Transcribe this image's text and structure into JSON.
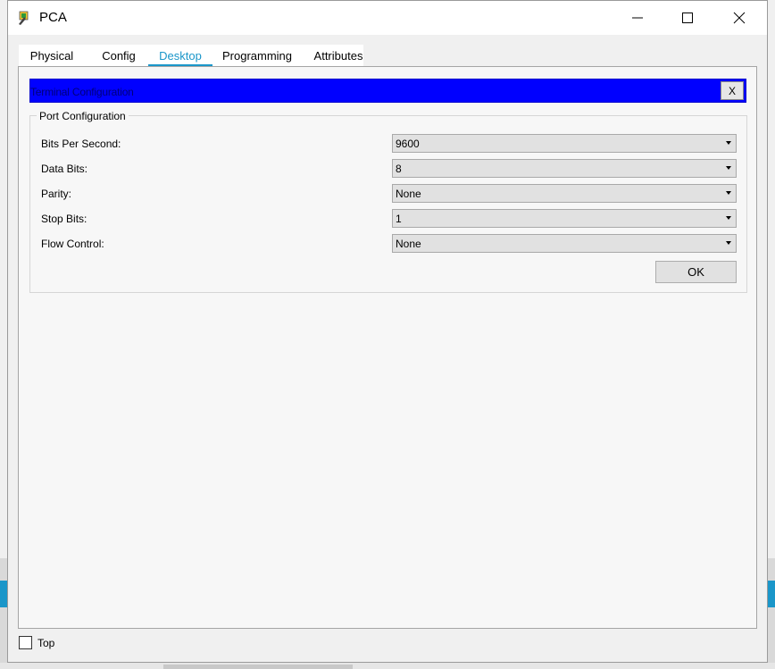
{
  "window": {
    "title": "PCA",
    "app_icon": "packet-tracer-pc-icon",
    "controls": [
      "minimize-icon",
      "maximize-icon",
      "close-icon"
    ]
  },
  "tabs": [
    {
      "label": "Physical",
      "active": false
    },
    {
      "label": "Config",
      "active": false
    },
    {
      "label": "Desktop",
      "active": true
    },
    {
      "label": "Programming",
      "active": false
    },
    {
      "label": "Attributes",
      "active": false
    }
  ],
  "terminal": {
    "title": "Terminal Configuration",
    "close_label": "X",
    "group_title": "Port Configuration",
    "fields": [
      {
        "label": "Bits Per Second:",
        "value": "9600"
      },
      {
        "label": "Data Bits:",
        "value": "8"
      },
      {
        "label": "Parity:",
        "value": "None"
      },
      {
        "label": "Stop Bits:",
        "value": "1"
      },
      {
        "label": "Flow Control:",
        "value": "None"
      }
    ],
    "ok_label": "OK"
  },
  "footer": {
    "top_label": "Top",
    "top_checked": false
  },
  "colors": {
    "accent": "#1a96c9",
    "terminal_header": "#0000ff"
  }
}
